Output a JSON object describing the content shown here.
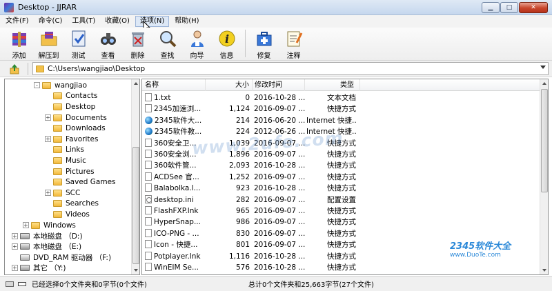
{
  "window": {
    "title": "Desktop - JJRAR",
    "min_label": "▁",
    "max_label": "□",
    "close_label": "✕"
  },
  "menu": [
    "文件(F)",
    "命令(C)",
    "工具(T)",
    "收藏(O)",
    "选项(N)",
    "帮助(H)"
  ],
  "toolbar": [
    "添加",
    "解压到",
    "测试",
    "查看",
    "删除",
    "查找",
    "向导",
    "信息",
    "修复",
    "注释"
  ],
  "address": {
    "path": "C:\\Users\\wangjiao\\Desktop"
  },
  "tree": [
    {
      "label": "wangjiao",
      "indent": 3,
      "exp": "-",
      "icon": "folder"
    },
    {
      "label": "Contacts",
      "indent": 4,
      "exp": "",
      "icon": "folder"
    },
    {
      "label": "Desktop",
      "indent": 4,
      "exp": "",
      "icon": "folder"
    },
    {
      "label": "Documents",
      "indent": 4,
      "exp": "+",
      "icon": "folder"
    },
    {
      "label": "Downloads",
      "indent": 4,
      "exp": "",
      "icon": "folder"
    },
    {
      "label": "Favorites",
      "indent": 4,
      "exp": "+",
      "icon": "folder"
    },
    {
      "label": "Links",
      "indent": 4,
      "exp": "",
      "icon": "folder"
    },
    {
      "label": "Music",
      "indent": 4,
      "exp": "",
      "icon": "folder"
    },
    {
      "label": "Pictures",
      "indent": 4,
      "exp": "",
      "icon": "folder"
    },
    {
      "label": "Saved Games",
      "indent": 4,
      "exp": "",
      "icon": "folder"
    },
    {
      "label": "SCC",
      "indent": 4,
      "exp": "+",
      "icon": "folder"
    },
    {
      "label": "Searches",
      "indent": 4,
      "exp": "",
      "icon": "folder"
    },
    {
      "label": "Videos",
      "indent": 4,
      "exp": "",
      "icon": "folder"
    },
    {
      "label": "Windows",
      "indent": 2,
      "exp": "+",
      "icon": "folder"
    },
    {
      "label": "本地磁盘 （D:)",
      "indent": 1,
      "exp": "+",
      "icon": "drive"
    },
    {
      "label": "本地磁盘 （E:)",
      "indent": 1,
      "exp": "+",
      "icon": "drive"
    },
    {
      "label": "DVD_RAM 驱动器 （F:)",
      "indent": 1,
      "exp": "",
      "icon": "dvd"
    },
    {
      "label": "其它 （Y:)",
      "indent": 1,
      "exp": "+",
      "icon": "drive"
    }
  ],
  "list": {
    "headers": [
      "名称",
      "大小",
      "修改时间",
      "类型"
    ],
    "rows": [
      {
        "name": "1.txt",
        "size": "0",
        "date": "2016-10-28 ...",
        "type": "文本文档",
        "icon": "doc"
      },
      {
        "name": "2345加速浏...",
        "size": "1,124",
        "date": "2016-09-07 ...",
        "type": "快捷方式",
        "icon": "doc"
      },
      {
        "name": "2345软件大...",
        "size": "214",
        "date": "2016-06-20 ...",
        "type": "Internet 快捷...",
        "icon": "globe"
      },
      {
        "name": "2345软件教...",
        "size": "224",
        "date": "2012-06-26 ...",
        "type": "Internet 快捷...",
        "icon": "globe"
      },
      {
        "name": "360安全卫...",
        "size": "1,039",
        "date": "2016-09-07 ...",
        "type": "快捷方式",
        "icon": "doc"
      },
      {
        "name": "360安全浏...",
        "size": "1,896",
        "date": "2016-09-07 ...",
        "type": "快捷方式",
        "icon": "doc"
      },
      {
        "name": "360软件管...",
        "size": "2,093",
        "date": "2016-10-28 ...",
        "type": "快捷方式",
        "icon": "doc"
      },
      {
        "name": "ACDSee 官...",
        "size": "1,252",
        "date": "2016-09-07 ...",
        "type": "快捷方式",
        "icon": "doc"
      },
      {
        "name": "Balabolka.l...",
        "size": "923",
        "date": "2016-10-28 ...",
        "type": "快捷方式",
        "icon": "doc"
      },
      {
        "name": "desktop.ini",
        "size": "282",
        "date": "2016-09-07 ...",
        "type": "配置设置",
        "icon": "gear"
      },
      {
        "name": "FlashFXP.lnk",
        "size": "965",
        "date": "2016-09-07 ...",
        "type": "快捷方式",
        "icon": "doc"
      },
      {
        "name": "HyperSnap...",
        "size": "986",
        "date": "2016-09-07 ...",
        "type": "快捷方式",
        "icon": "doc"
      },
      {
        "name": "ICO-PNG - ...",
        "size": "830",
        "date": "2016-09-07 ...",
        "type": "快捷方式",
        "icon": "doc"
      },
      {
        "name": "Icon - 快捷...",
        "size": "801",
        "date": "2016-09-07 ...",
        "type": "快捷方式",
        "icon": "doc"
      },
      {
        "name": "Potplayer.lnk",
        "size": "1,116",
        "date": "2016-10-28 ...",
        "type": "快捷方式",
        "icon": "doc"
      },
      {
        "name": "WinEIM Se...",
        "size": "576",
        "date": "2016-10-28 ...",
        "type": "快捷方式",
        "icon": "doc"
      }
    ]
  },
  "status": {
    "left": "已经选择0个文件夹和0字节(0个文件)",
    "right": "总计0个文件夹和25,663字节(27个文件)"
  },
  "watermark": {
    "text": "www.2ufe.com",
    "logo": "2345软件大全",
    "logo_url": "www.DuoTe.com"
  }
}
